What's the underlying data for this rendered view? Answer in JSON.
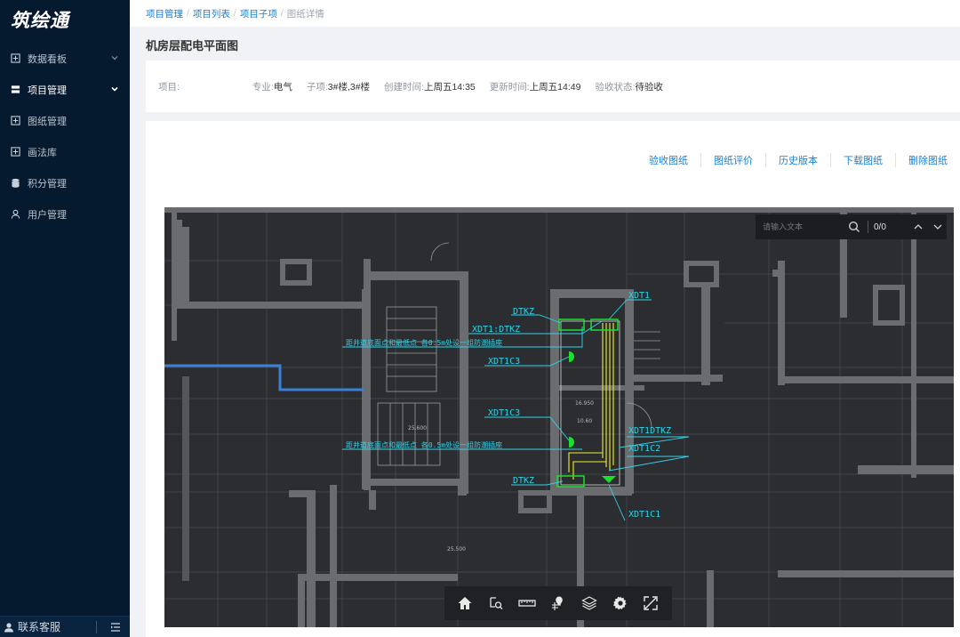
{
  "app": {
    "logo": "筑绘通"
  },
  "sidebar": {
    "items": [
      {
        "label": "数据看板",
        "icon": "dashboard-icon",
        "has_chevron": true,
        "expanded": false
      },
      {
        "label": "项目管理",
        "icon": "server-icon",
        "has_chevron": true,
        "expanded": true,
        "active": true
      },
      {
        "label": "图纸管理",
        "icon": "drawing-icon",
        "has_chevron": false
      },
      {
        "label": "画法库",
        "icon": "library-icon",
        "has_chevron": false
      },
      {
        "label": "积分管理",
        "icon": "database-icon",
        "has_chevron": false
      },
      {
        "label": "用户管理",
        "icon": "user-icon",
        "has_chevron": false
      }
    ],
    "footer": {
      "label": "联系客服",
      "icon": "support-icon"
    }
  },
  "breadcrumb": [
    "项目管理",
    "项目列表",
    "项目子项",
    "图纸详情"
  ],
  "page": {
    "title": "机房层配电平面图"
  },
  "info": {
    "project_label": "项目:",
    "project_value": "",
    "discipline_label": "专业:",
    "discipline_value": "电气",
    "subitem_label": "子项:",
    "subitem_value": "3#楼,3#楼",
    "created_label": "创建时间:",
    "created_value": "上周五14:35",
    "updated_label": "更新时间:",
    "updated_value": "上周五14:49",
    "status_label": "验收状态:",
    "status_value": "待验收"
  },
  "actions": [
    "验收图纸",
    "图纸评价",
    "历史版本",
    "下载图纸",
    "删除图纸"
  ],
  "viewer": {
    "search_placeholder": "请输入文本",
    "search_value": "",
    "match_count": "0/0",
    "cad_labels": {
      "dtkz_top": "DTKZ",
      "xdt1": "XDT1",
      "xdt1_dtkz": "XDT1:DTKZ",
      "xdt1_c3_a": "XDT1C3",
      "xdt1_c3_b": "XDT1C3",
      "xdt1_dtkz_b": "XDT1DTKZ",
      "xdt1_c2": "XDT1C2",
      "dtkz_bottom": "DTKZ",
      "xdt1_c1": "XDT1C1",
      "note_a": "距井道底面点和最低点 各0.5m处设一组防潮插座",
      "note_b": "距井道底面点和最低点 各0.5m处设一组防潮插座",
      "small_a": "25.600",
      "small_b": "25.500",
      "small_c": "10.60",
      "small_d": "16.950"
    },
    "colors": {
      "cyan": "#2fd3e6",
      "green": "#19e12b",
      "yellow": "#f2ef2a",
      "wall": "#6b6c70",
      "blue": "#3b7fd6"
    },
    "tools": [
      {
        "name": "home-icon"
      },
      {
        "name": "zoom-window-icon"
      },
      {
        "name": "measure-icon"
      },
      {
        "name": "location-pin-icon"
      },
      {
        "name": "layers-icon"
      },
      {
        "name": "settings-gear-icon"
      },
      {
        "name": "fullscreen-icon"
      }
    ]
  }
}
